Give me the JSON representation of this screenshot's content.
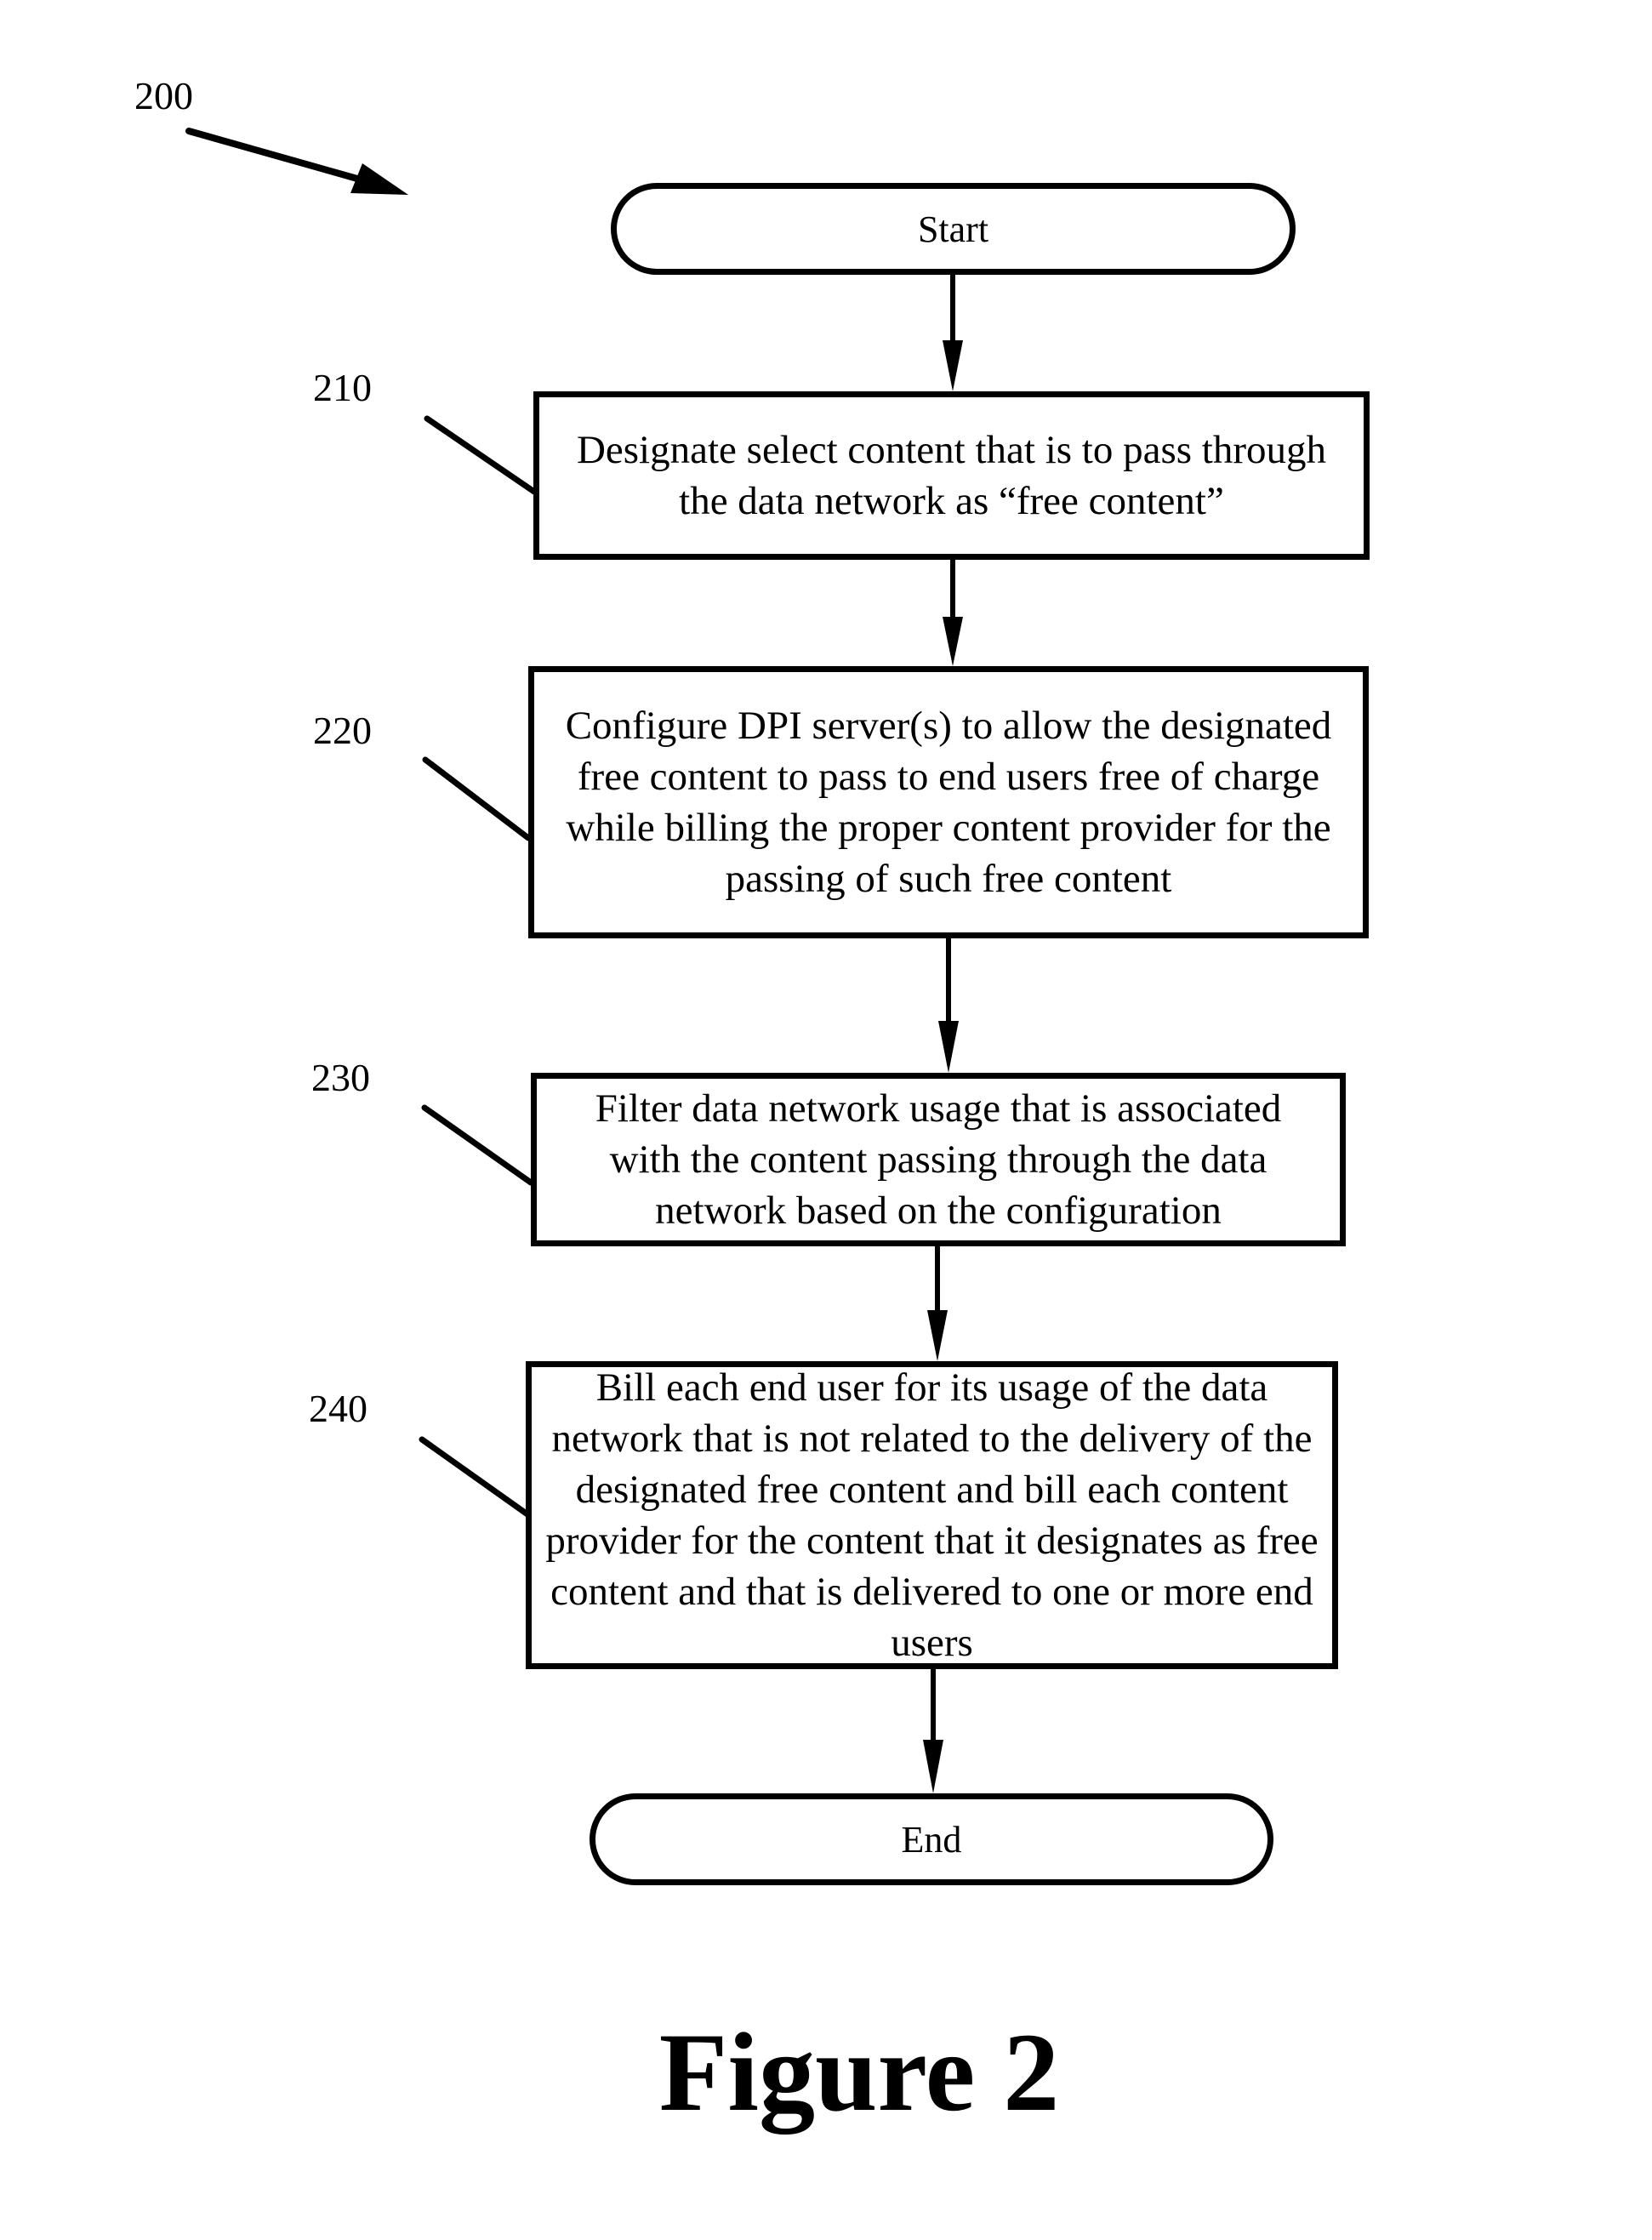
{
  "figure": {
    "reference_number": "200",
    "caption": "Figure 2"
  },
  "flowchart": {
    "start": {
      "label": "Start"
    },
    "steps": [
      {
        "ref": "210",
        "text": "Designate select content that is to pass through the data network as “free content”"
      },
      {
        "ref": "220",
        "text": "Configure DPI server(s) to allow the designated free content to pass to end users free of charge while billing the proper content provider for the passing of such free content"
      },
      {
        "ref": "230",
        "text": "Filter data network usage that is associated with the content passing through the data network based on the configuration"
      },
      {
        "ref": "240",
        "text": "Bill each end user for its usage of the data network that is not related to the delivery of the designated free content and bill each content provider for the content that it designates as free content and that is delivered to one or more end users"
      }
    ],
    "end": {
      "label": "End"
    }
  }
}
